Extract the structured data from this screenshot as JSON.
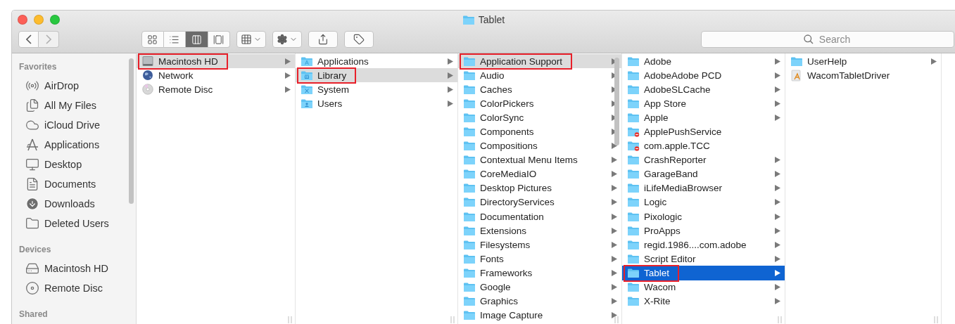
{
  "window": {
    "title": "Tablet"
  },
  "toolbar": {
    "nav": [
      {
        "kind": "back",
        "disabled": false
      },
      {
        "kind": "forward",
        "disabled": true
      }
    ],
    "view_modes": [
      {
        "kind": "icons",
        "selected": false
      },
      {
        "kind": "list",
        "selected": false
      },
      {
        "kind": "columns",
        "selected": true
      },
      {
        "kind": "cover-flow",
        "selected": false
      }
    ],
    "buttons": [
      {
        "kind": "arrange"
      },
      {
        "kind": "action"
      },
      {
        "kind": "share"
      },
      {
        "kind": "tags"
      }
    ],
    "search": {
      "placeholder": "Search"
    }
  },
  "sidebar": {
    "sections": [
      {
        "title": "Favorites",
        "items": [
          {
            "label": "AirDrop",
            "kind": "airdrop",
            "selected": false
          },
          {
            "label": "All My Files",
            "kind": "files",
            "selected": false
          },
          {
            "label": "iCloud Drive",
            "kind": "cloud",
            "selected": false
          },
          {
            "label": "Applications",
            "kind": "apps",
            "selected": false
          },
          {
            "label": "Desktop",
            "kind": "desktop",
            "selected": false
          },
          {
            "label": "Documents",
            "kind": "documents",
            "selected": false
          },
          {
            "label": "Downloads",
            "kind": "downloads",
            "selected": false
          },
          {
            "label": "Deleted Users",
            "kind": "folder",
            "selected": false
          }
        ]
      },
      {
        "title": "Devices",
        "items": [
          {
            "label": "Macintosh HD",
            "kind": "drive",
            "selected": false
          },
          {
            "label": "Remote Disc",
            "kind": "disc",
            "selected": false
          }
        ]
      },
      {
        "title": "Shared"
      }
    ]
  },
  "columns": [
    {
      "focused": false,
      "items": [
        {
          "name": "Macintosh HD",
          "kind": "drive",
          "has_children": true,
          "selected": true,
          "annotated": true
        },
        {
          "name": "Network",
          "kind": "network",
          "has_children": true,
          "selected": false,
          "annotated": false
        },
        {
          "name": "Remote Disc",
          "kind": "disc",
          "has_children": true,
          "selected": false,
          "annotated": false
        }
      ]
    },
    {
      "focused": false,
      "items": [
        {
          "name": "Applications",
          "kind": "folder-apps",
          "has_children": true,
          "selected": false,
          "annotated": false
        },
        {
          "name": "Library",
          "kind": "folder-library",
          "has_children": true,
          "selected": true,
          "annotated": true
        },
        {
          "name": "System",
          "kind": "folder-system",
          "has_children": true,
          "selected": false,
          "annotated": false
        },
        {
          "name": "Users",
          "kind": "folder-users",
          "has_children": true,
          "selected": false,
          "annotated": false
        }
      ]
    },
    {
      "focused": false,
      "items": [
        {
          "name": "Application Support",
          "kind": "folder",
          "has_children": true,
          "selected": true,
          "annotated": true
        },
        {
          "name": "Audio",
          "kind": "folder",
          "has_children": true,
          "selected": false,
          "annotated": false
        },
        {
          "name": "Caches",
          "kind": "folder",
          "has_children": true,
          "selected": false,
          "annotated": false
        },
        {
          "name": "ColorPickers",
          "kind": "folder",
          "has_children": true,
          "selected": false,
          "annotated": false
        },
        {
          "name": "ColorSync",
          "kind": "folder",
          "has_children": true,
          "selected": false,
          "annotated": false
        },
        {
          "name": "Components",
          "kind": "folder",
          "has_children": true,
          "selected": false,
          "annotated": false
        },
        {
          "name": "Compositions",
          "kind": "folder",
          "has_children": true,
          "selected": false,
          "annotated": false
        },
        {
          "name": "Contextual Menu Items",
          "kind": "folder",
          "has_children": true,
          "selected": false,
          "annotated": false
        },
        {
          "name": "CoreMediaIO",
          "kind": "folder",
          "has_children": true,
          "selected": false,
          "annotated": false
        },
        {
          "name": "Desktop Pictures",
          "kind": "folder",
          "has_children": true,
          "selected": false,
          "annotated": false
        },
        {
          "name": "DirectoryServices",
          "kind": "folder",
          "has_children": true,
          "selected": false,
          "annotated": false
        },
        {
          "name": "Documentation",
          "kind": "folder",
          "has_children": true,
          "selected": false,
          "annotated": false
        },
        {
          "name": "Extensions",
          "kind": "folder",
          "has_children": true,
          "selected": false,
          "annotated": false
        },
        {
          "name": "Filesystems",
          "kind": "folder",
          "has_children": true,
          "selected": false,
          "annotated": false
        },
        {
          "name": "Fonts",
          "kind": "folder",
          "has_children": true,
          "selected": false,
          "annotated": false
        },
        {
          "name": "Frameworks",
          "kind": "folder",
          "has_children": true,
          "selected": false,
          "annotated": false
        },
        {
          "name": "Google",
          "kind": "folder",
          "has_children": true,
          "selected": false,
          "annotated": false
        },
        {
          "name": "Graphics",
          "kind": "folder",
          "has_children": true,
          "selected": false,
          "annotated": false
        },
        {
          "name": "Image Capture",
          "kind": "folder",
          "has_children": true,
          "selected": false,
          "annotated": false
        }
      ]
    },
    {
      "focused": true,
      "items": [
        {
          "name": "Adobe",
          "kind": "folder",
          "has_children": true,
          "selected": false,
          "annotated": false
        },
        {
          "name": "AdobeAdobe PCD",
          "kind": "folder",
          "has_children": true,
          "selected": false,
          "annotated": false
        },
        {
          "name": "AdobeSLCache",
          "kind": "folder",
          "has_children": true,
          "selected": false,
          "annotated": false
        },
        {
          "name": "App Store",
          "kind": "folder",
          "has_children": true,
          "selected": false,
          "annotated": false
        },
        {
          "name": "Apple",
          "kind": "folder",
          "has_children": true,
          "selected": false,
          "annotated": false
        },
        {
          "name": "ApplePushService",
          "kind": "folder-restricted",
          "has_children": false,
          "selected": false,
          "annotated": false
        },
        {
          "name": "com.apple.TCC",
          "kind": "folder-restricted",
          "has_children": false,
          "selected": false,
          "annotated": false
        },
        {
          "name": "CrashReporter",
          "kind": "folder",
          "has_children": true,
          "selected": false,
          "annotated": false
        },
        {
          "name": "GarageBand",
          "kind": "folder",
          "has_children": true,
          "selected": false,
          "annotated": false
        },
        {
          "name": "iLifeMediaBrowser",
          "kind": "folder",
          "has_children": true,
          "selected": false,
          "annotated": false
        },
        {
          "name": "Logic",
          "kind": "folder",
          "has_children": true,
          "selected": false,
          "annotated": false
        },
        {
          "name": "Pixologic",
          "kind": "folder",
          "has_children": true,
          "selected": false,
          "annotated": false
        },
        {
          "name": "ProApps",
          "kind": "folder",
          "has_children": true,
          "selected": false,
          "annotated": false
        },
        {
          "name": "regid.1986....com.adobe",
          "kind": "folder",
          "has_children": true,
          "selected": false,
          "annotated": false
        },
        {
          "name": "Script Editor",
          "kind": "folder",
          "has_children": true,
          "selected": false,
          "annotated": false
        },
        {
          "name": "Tablet",
          "kind": "folder",
          "has_children": true,
          "selected": true,
          "annotated": true
        },
        {
          "name": "Wacom",
          "kind": "folder",
          "has_children": true,
          "selected": false,
          "annotated": false
        },
        {
          "name": "X-Rite",
          "kind": "folder",
          "has_children": true,
          "selected": false,
          "annotated": false
        }
      ]
    },
    {
      "focused": false,
      "items": [
        {
          "name": "UserHelp",
          "kind": "folder",
          "has_children": true,
          "selected": false,
          "annotated": false
        },
        {
          "name": "WacomTabletDriver",
          "kind": "app",
          "has_children": false,
          "selected": false,
          "annotated": false
        }
      ]
    }
  ]
}
